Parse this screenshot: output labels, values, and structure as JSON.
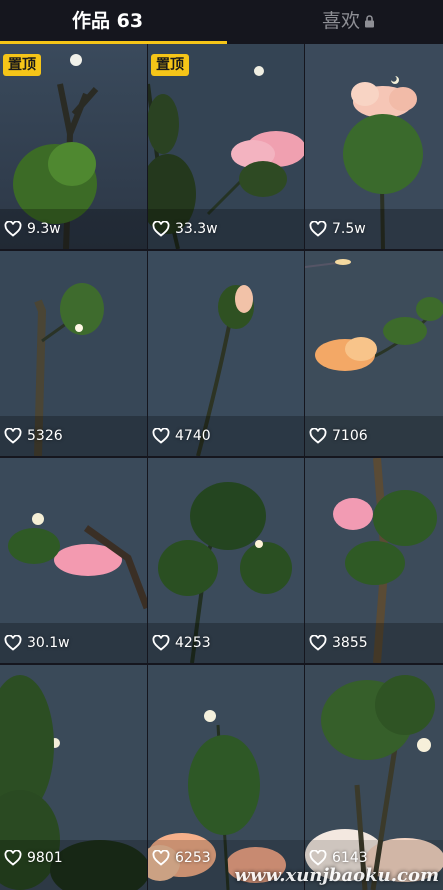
{
  "tabs": {
    "works_label": "作品 63",
    "likes_label": "喜欢",
    "likes_icon": "lock-icon"
  },
  "colors": {
    "accent": "#f5c518",
    "background": "#15161e",
    "inactive_tab": "#8e8f95"
  },
  "grid": {
    "items": [
      {
        "pinned_label": "置顶",
        "likes": "9.3w"
      },
      {
        "pinned_label": "置顶",
        "likes": "33.3w"
      },
      {
        "likes": "7.5w"
      },
      {
        "likes": "5326"
      },
      {
        "likes": "4740"
      },
      {
        "likes": "7106"
      },
      {
        "likes": "30.1w"
      },
      {
        "likes": "4253"
      },
      {
        "likes": "3855"
      },
      {
        "likes": "9801"
      },
      {
        "likes": "6253"
      },
      {
        "likes": "6143"
      }
    ]
  },
  "watermark": "www.xunjbaoku.com"
}
